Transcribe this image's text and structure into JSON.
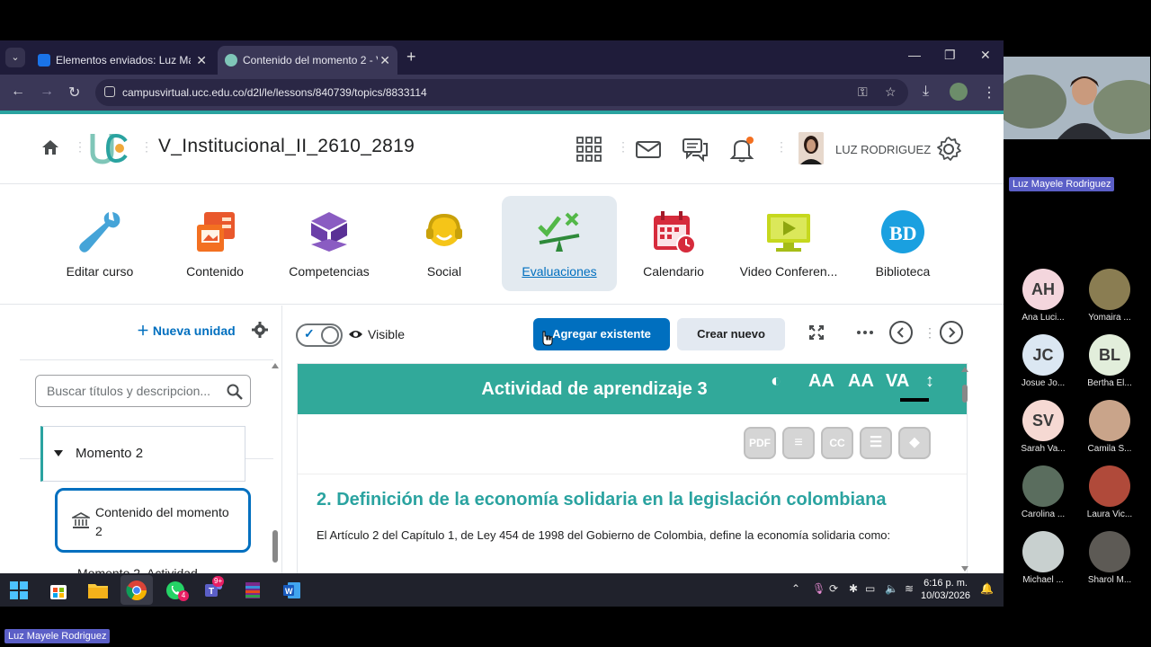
{
  "browser": {
    "tabs": [
      {
        "label": "Elementos enviados: Luz Mayele",
        "active": false
      },
      {
        "label": "Contenido del momento 2 - V_I",
        "active": true
      }
    ],
    "url": "campusvirtual.ucc.edu.co/d2l/le/lessons/840739/topics/8833114"
  },
  "header": {
    "course_title": "V_Institucional_II_2610_2819",
    "user_name": "LUZ RODRIGUEZ"
  },
  "nav_tools": [
    {
      "label": "Editar curso",
      "icon": "wrench-icon"
    },
    {
      "label": "Contenido",
      "icon": "content-icon"
    },
    {
      "label": "Competencias",
      "icon": "cube-icon"
    },
    {
      "label": "Social",
      "icon": "headset-icon"
    },
    {
      "label": "Evaluaciones",
      "icon": "scale-icon",
      "active": true
    },
    {
      "label": "Calendario",
      "icon": "calendar-icon"
    },
    {
      "label": "Video Conferen...",
      "icon": "video-icon"
    },
    {
      "label": "Biblioteca",
      "icon": "library-icon"
    }
  ],
  "left_panel": {
    "new_unit_label": "Nueva unidad",
    "search_placeholder": "Buscar títulos y descripcion...",
    "tree": {
      "unit": "Momento 2",
      "active_topic": "Contenido del momento 2",
      "next_item": "Momento 2. Actividad"
    }
  },
  "toolbar": {
    "visibility_label": "Visible",
    "add_existing": "Agregar existente",
    "create_new": "Crear nuevo"
  },
  "content": {
    "banner_title": "Actividad de aprendizaje 3",
    "a11y_buttons": [
      "AA",
      "AA",
      "VA"
    ],
    "doc_buttons": [
      "PDF",
      "CC"
    ],
    "section_heading": "2. Definición de la economía solidaria en la legislación colombiana",
    "section_text": "El Artículo 2 del Capítulo 1, de Ley 454 de 1998 del Gobierno de Colombia, define la economía solidaria como:"
  },
  "taskbar": {
    "whatsapp_badge": "4",
    "teams_badge": "9+",
    "time": "6:16 p. m.",
    "date": "10/03/2026"
  },
  "meeting": {
    "presenter_name": "Luz Mayele Rodriguez",
    "self_name_tag": "Luz Mayele Rodriguez",
    "participants": [
      {
        "initials": "AH",
        "name": "Ana Luci...",
        "color": "#f4d6dd"
      },
      {
        "initials": "",
        "name": "Yomaira ...",
        "color": "#8a7d52"
      },
      {
        "initials": "JC",
        "name": "Josue Jo...",
        "color": "#dbe7f2"
      },
      {
        "initials": "BL",
        "name": "Bertha El...",
        "color": "#e2eedb"
      },
      {
        "initials": "SV",
        "name": "Sarah Va...",
        "color": "#f6d9d3"
      },
      {
        "initials": "",
        "name": "Camila S...",
        "color": "#c9a48a"
      },
      {
        "initials": "",
        "name": "Carolina ...",
        "color": "#5a6d5e"
      },
      {
        "initials": "",
        "name": "Laura Vic...",
        "color": "#b04a3a"
      },
      {
        "initials": "",
        "name": "Michael ...",
        "color": "#c8d0cf"
      },
      {
        "initials": "",
        "name": "Sharol M...",
        "color": "#5d5a55"
      }
    ]
  },
  "colors": {
    "brand_teal": "#2aa3a0",
    "primary_blue": "#006fbf",
    "banner_green": "#31a99a"
  }
}
